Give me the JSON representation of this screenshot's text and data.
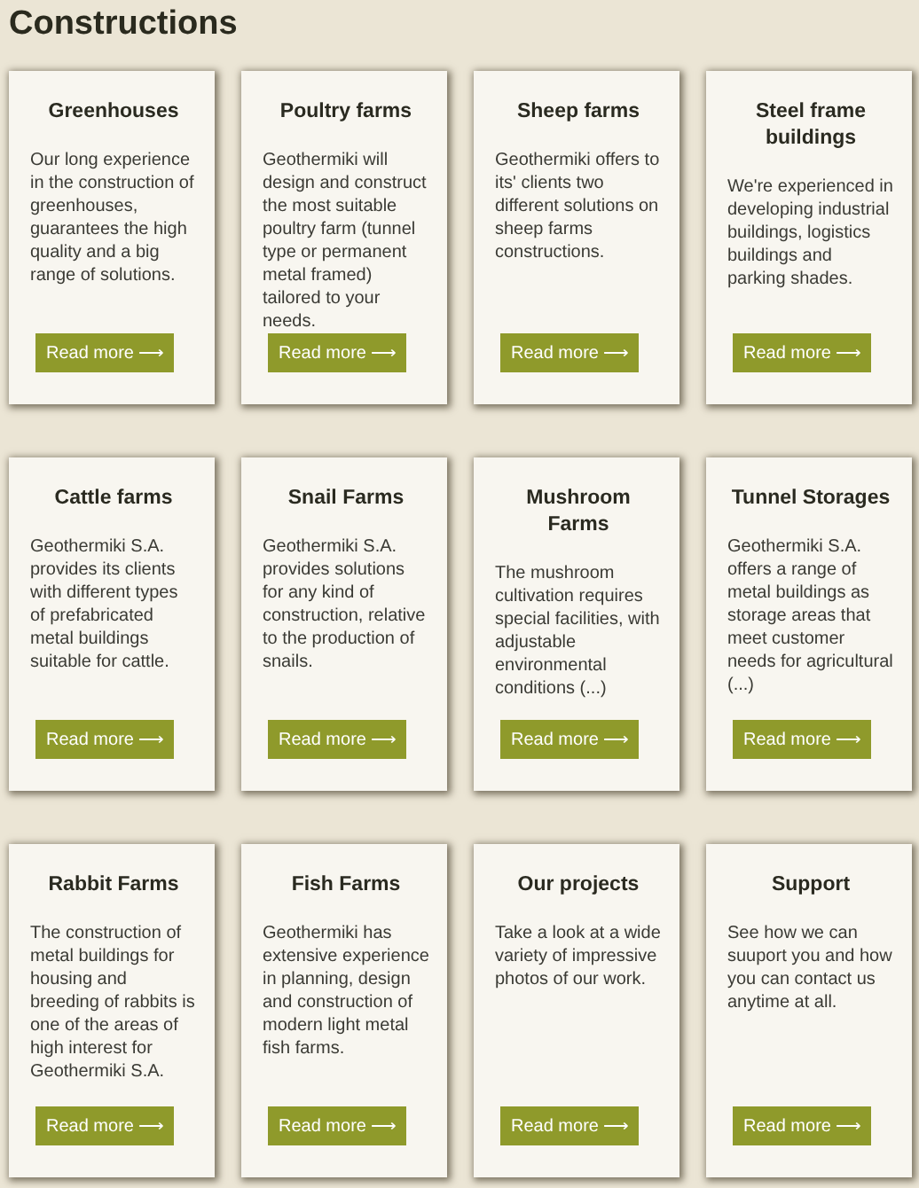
{
  "heading": "Constructions",
  "cards": [
    {
      "title": "Greenhouses",
      "text": "Our long experience in the construction of greenhouses, guarantees the high quality and a big range of solutions.",
      "button": "Read more ⟶"
    },
    {
      "title": "Poultry farms",
      "text": "Geothermiki will design and construct the most suitable poultry farm (tunnel type or permanent metal framed) tailored to your needs.",
      "button": "Read more ⟶"
    },
    {
      "title": "Sheep farms",
      "text": "Geothermiki offers to its' clients two different solutions on sheep farms constructions.",
      "button": "Read more ⟶"
    },
    {
      "title": "Steel frame buildings",
      "text": "We're experienced in developing industrial buildings, logistics buildings and parking shades.",
      "button": "Read more ⟶"
    },
    {
      "title": "Cattle farms",
      "text": "Geothermiki S.A. provides its clients with different types of prefabricated metal buildings suitable for cattle.",
      "button": "Read more ⟶"
    },
    {
      "title": "Snail Farms",
      "text": "Geothermiki S.A. provides solutions for any kind of construction, relative to the production of snails.",
      "button": "Read more ⟶"
    },
    {
      "title": "Mushroom Farms",
      "text": "The mushroom cultivation requires special facilities, with adjustable environmental conditions (...)",
      "button": "Read more ⟶"
    },
    {
      "title": "Tunnel Storages",
      "text": "Geothermiki S.A. offers a range of metal buildings as storage areas that meet customer needs for agricultural (...)",
      "button": "Read more ⟶"
    },
    {
      "title": "Rabbit Farms",
      "text": "The construction of metal buildings for housing and breeding of rabbits is one of the areas of high interest for Geothermiki S.A.",
      "button": "Read more ⟶"
    },
    {
      "title": "Fish Farms",
      "text": "Geothermiki has extensive experience in planning, design and construction of modern light metal fish farms.",
      "button": "Read more ⟶"
    },
    {
      "title": "Our projects",
      "text": "Take a look at a wide variety of impressive photos of our work.",
      "button": "Read more ⟶"
    },
    {
      "title": "Support",
      "text": "See how we can suuport you and how you can contact us anytime at all.",
      "button": "Read more ⟶"
    }
  ]
}
